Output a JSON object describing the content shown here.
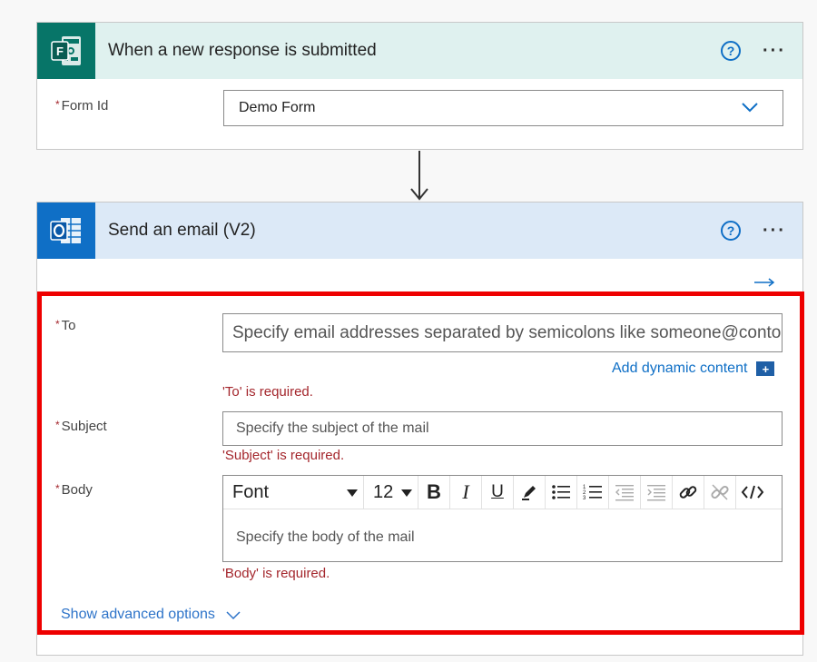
{
  "trigger": {
    "title": "When a new response is submitted",
    "help_icon": "?",
    "more_icon": "···",
    "form_id_label": "Form Id",
    "form_id_value": "Demo Form"
  },
  "action": {
    "title": "Send an email (V2)",
    "help_icon": "?",
    "more_icon": "···",
    "to": {
      "label": "To",
      "placeholder": "Specify email addresses separated by semicolons like someone@contoso.com",
      "error": "'To' is required."
    },
    "dynamic_content": {
      "label": "Add dynamic content",
      "plus": "+"
    },
    "subject": {
      "label": "Subject",
      "placeholder": "Specify the subject of the mail",
      "error": "'Subject' is required."
    },
    "body": {
      "label": "Body",
      "placeholder": "Specify the body of the mail",
      "error": "'Body' is required.",
      "toolbar": {
        "font": "Font",
        "size": "12",
        "bold": "B",
        "italic": "I",
        "underline": "U"
      }
    },
    "advanced_options": "Show advanced options"
  },
  "colors": {
    "forms_green": "#077568",
    "outlook_blue": "#0f6fc6",
    "error_red": "#a4262c",
    "highlight_red": "#ee0000"
  },
  "icons": [
    "forms-icon",
    "outlook-icon",
    "help-icon",
    "more-icon",
    "chevron-down-icon",
    "arrow-down-icon",
    "arrow-right-icon",
    "plus-icon",
    "pen-icon",
    "bullet-list-icon",
    "numbered-list-icon",
    "decrease-indent-icon",
    "increase-indent-icon",
    "link-icon",
    "unlink-icon",
    "code-view-icon"
  ]
}
